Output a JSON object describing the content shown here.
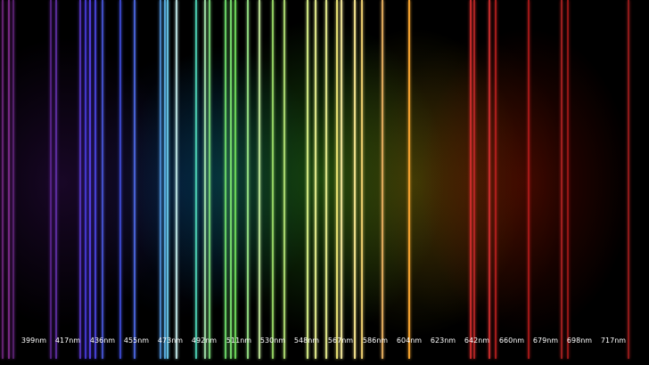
{
  "image": {
    "subject": "emission spectrum",
    "background_color": "#000000"
  },
  "scale": {
    "unit": "nm",
    "labels": [
      "399nm",
      "417nm",
      "436nm",
      "455nm",
      "473nm",
      "492nm",
      "511nm",
      "530nm",
      "548nm",
      "567nm",
      "586nm",
      "604nm",
      "623nm",
      "642nm",
      "660nm",
      "679nm",
      "698nm",
      "717nm"
    ]
  },
  "spectral_lines": [
    {
      "color": "#7a2a8a",
      "opacity": 0.8
    },
    {
      "color": "#8a3098",
      "opacity": 0.85
    },
    {
      "color": "#6f2a8c",
      "opacity": 0.75
    },
    {
      "color": "#6a2ca6",
      "opacity": 0.75
    },
    {
      "color": "#6c35b8",
      "opacity": 0.8
    },
    {
      "color": "#5c3ad0",
      "opacity": 0.85
    },
    {
      "color": "#4a3ce0",
      "opacity": 0.9
    },
    {
      "color": "#5440e8",
      "opacity": 0.95
    },
    {
      "color": "#4d46e6",
      "opacity": 0.9
    },
    {
      "color": "#4d5ce6",
      "opacity": 0.85
    },
    {
      "color": "#3f4cd8",
      "opacity": 0.9
    },
    {
      "color": "#4e6be8",
      "opacity": 0.9
    },
    {
      "color": "#4e8fd8",
      "opacity": 0.9
    },
    {
      "color": "#56a8e0",
      "opacity": 0.95
    },
    {
      "color": "#6ac8e8",
      "opacity": 0.95
    },
    {
      "color": "#bfe6e6",
      "opacity": 0.95
    },
    {
      "color": "#4fd6b8",
      "opacity": 0.9
    },
    {
      "color": "#a8e8b0",
      "opacity": 0.9
    },
    {
      "color": "#7de07a",
      "opacity": 0.9
    },
    {
      "color": "#6dd86a",
      "opacity": 0.95
    },
    {
      "color": "#7ae070",
      "opacity": 0.95
    },
    {
      "color": "#6edc5a",
      "opacity": 0.95
    },
    {
      "color": "#9be889",
      "opacity": 0.9
    },
    {
      "color": "#c8f0a0",
      "opacity": 0.9
    },
    {
      "color": "#9ee06a",
      "opacity": 0.9
    },
    {
      "color": "#b8e878",
      "opacity": 0.9
    },
    {
      "color": "#d8f088",
      "opacity": 0.95
    },
    {
      "color": "#e8f090",
      "opacity": 0.95
    },
    {
      "color": "#e6ec8e",
      "opacity": 0.95
    },
    {
      "color": "#f0e878",
      "opacity": 0.95
    },
    {
      "color": "#f4e89c",
      "opacity": 0.95
    },
    {
      "color": "#f8e690",
      "opacity": 0.95
    },
    {
      "color": "#f0d070",
      "opacity": 0.95
    },
    {
      "color": "#e8b060",
      "opacity": 0.95
    },
    {
      "color": "#f0a030",
      "opacity": 1
    },
    {
      "color": "#d83030",
      "opacity": 0.9
    },
    {
      "color": "#c42828",
      "opacity": 0.85
    },
    {
      "color": "#d43030",
      "opacity": 0.9
    },
    {
      "color": "#c02020",
      "opacity": 0.85
    },
    {
      "color": "#b81c1c",
      "opacity": 0.85
    },
    {
      "color": "#c02626",
      "opacity": 0.8
    },
    {
      "color": "#a81a1a",
      "opacity": 0.85
    },
    {
      "color": "#b02020",
      "opacity": 0.8
    }
  ]
}
